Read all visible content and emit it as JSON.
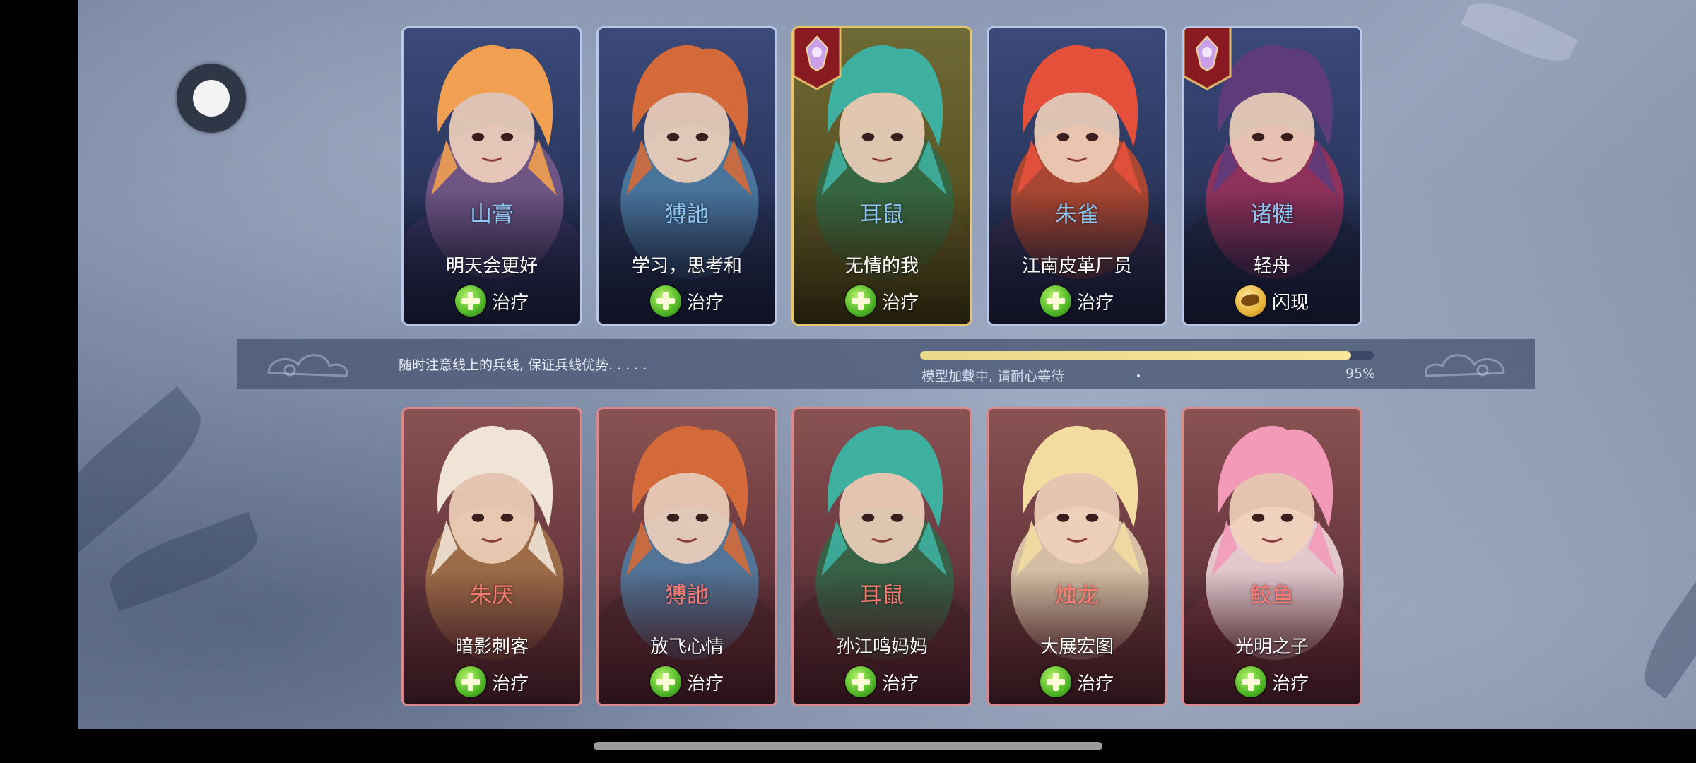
{
  "loading": {
    "tip": "随时注意线上的兵线, 保证兵线优势. . . . .",
    "status": "模型加载中, 请耐心等待",
    "percent_label": "95%",
    "progress": 0.95
  },
  "ally_team": [
    {
      "hero": "山膏",
      "player": "明天会更好",
      "skill": "治疗",
      "skill_icon": "heal-icon",
      "rank_badge": false,
      "selected": false,
      "palette": [
        "#f0a050",
        "#7a5a8a",
        "#3c3464"
      ]
    },
    {
      "hero": "猼訑",
      "player": "学习，思考和",
      "skill": "治疗",
      "skill_icon": "heal-icon",
      "rank_badge": false,
      "selected": false,
      "palette": [
        "#d46a3a",
        "#4f7fa6",
        "#2b3556"
      ]
    },
    {
      "hero": "耳鼠",
      "player": "无情的我",
      "skill": "治疗",
      "skill_icon": "heal-icon",
      "rank_badge": true,
      "selected": true,
      "palette": [
        "#3eb0a0",
        "#2f6a48",
        "#5a5126"
      ]
    },
    {
      "hero": "朱雀",
      "player": "江南皮革厂员",
      "skill": "治疗",
      "skill_icon": "heal-icon",
      "rank_badge": false,
      "selected": false,
      "palette": [
        "#e4503a",
        "#c04a2a",
        "#3a2d4c"
      ]
    },
    {
      "hero": "诸犍",
      "player": "轻舟",
      "skill": "闪现",
      "skill_icon": "flash-icon",
      "rank_badge": true,
      "selected": false,
      "palette": [
        "#5e3c7a",
        "#a0305a",
        "#242842"
      ]
    }
  ],
  "enemy_team": [
    {
      "hero": "朱厌",
      "player": "暗影刺客",
      "skill": "治疗",
      "skill_icon": "heal-icon",
      "palette": [
        "#efe4d6",
        "#a6744a",
        "#5a3a3a"
      ]
    },
    {
      "hero": "猼訑",
      "player": "放飞心情",
      "skill": "治疗",
      "skill_icon": "heal-icon",
      "palette": [
        "#d46a3a",
        "#4f7fa6",
        "#4a2a32"
      ]
    },
    {
      "hero": "耳鼠",
      "player": "孙江鸣妈妈",
      "skill": "治疗",
      "skill_icon": "heal-icon",
      "palette": [
        "#3eb0a0",
        "#2f6a48",
        "#4a2a32"
      ]
    },
    {
      "hero": "烛龙",
      "player": "大展宏图",
      "skill": "治疗",
      "skill_icon": "heal-icon",
      "palette": [
        "#f2dca0",
        "#e8d6b6",
        "#5a3a36"
      ]
    },
    {
      "hero": "鲛鱼",
      "player": "光明之子",
      "skill": "治疗",
      "skill_icon": "heal-icon",
      "palette": [
        "#f29ab8",
        "#f8e2e6",
        "#6a3444"
      ]
    }
  ]
}
